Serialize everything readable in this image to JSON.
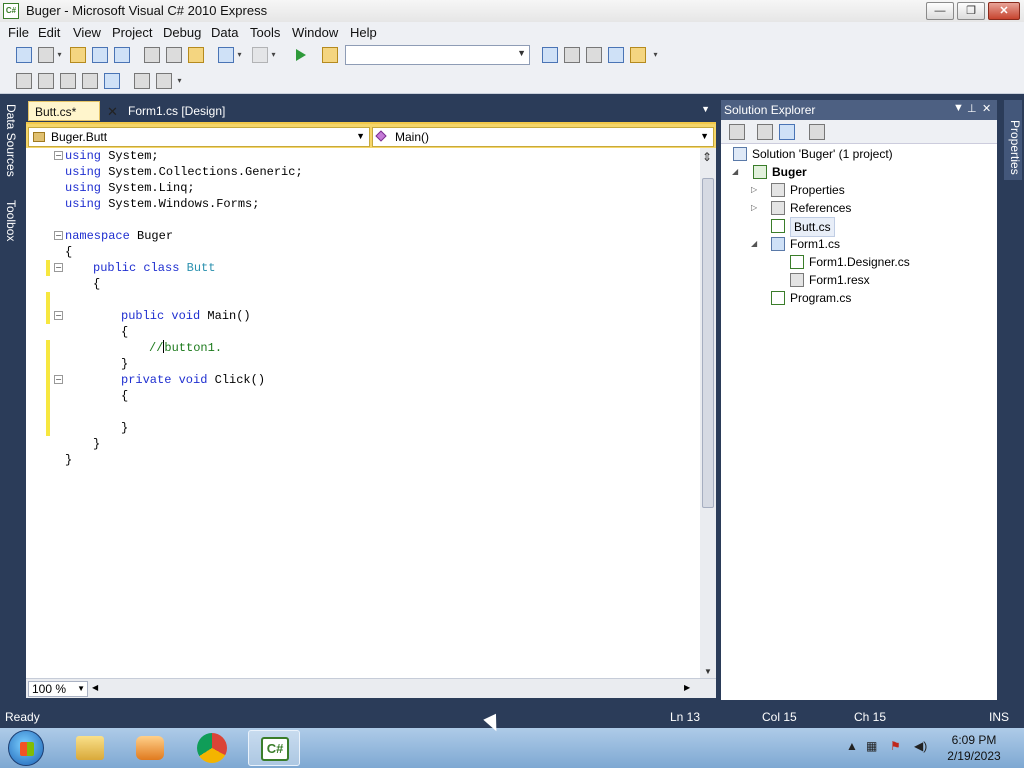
{
  "window": {
    "title": "Buger - Microsoft Visual C# 2010 Express",
    "icon_text": "C#",
    "buttons": {
      "minimize": "—",
      "maximize": "❐",
      "close": "✕"
    }
  },
  "menu": [
    "File",
    "Edit",
    "View",
    "Project",
    "Debug",
    "Data",
    "Tools",
    "Window",
    "Help"
  ],
  "toolbar": {
    "config_combo_value": ""
  },
  "side_tabs": {
    "left_top": "Data Sources",
    "left_bottom": "Toolbox",
    "right": "Properties"
  },
  "editor": {
    "tabs": [
      {
        "label": "Butt.cs*",
        "active": true
      },
      {
        "label": "Form1.cs [Design]",
        "active": false
      }
    ],
    "tab_close": "✕",
    "type_combo": "Buger.Butt",
    "member_combo": "Main()",
    "zoom": "100 %",
    "code": {
      "l1_kw": "using",
      "l1_rest": " System;",
      "l2_kw": "using",
      "l2_rest": " System.Collections.Generic;",
      "l3_kw": "using",
      "l3_rest": " System.Linq;",
      "l4_kw": "using",
      "l4_rest": " System.Windows.Forms;",
      "l6_kw": "namespace",
      "l6_rest": " Buger",
      "l7": "{",
      "l8_kw": "public class",
      "l8_type": "Butt",
      "l9": "{",
      "l11_kw": "public void",
      "l11_rest": " Main()",
      "l12": "{",
      "l13_a": "//",
      "l13_b": "button1.",
      "l14": "}",
      "l15_kw": "private void",
      "l15_rest": " Click()",
      "l16": "{",
      "l18": "}",
      "l19": "}",
      "l20": "}"
    }
  },
  "solution_explorer": {
    "title": "Solution Explorer",
    "nodes": {
      "solution": "Solution 'Buger' (1 project)",
      "project": "Buger",
      "properties": "Properties",
      "references": "References",
      "butt": "Butt.cs",
      "form1": "Form1.cs",
      "form1_designer": "Form1.Designer.cs",
      "form1_resx": "Form1.resx",
      "program": "Program.cs"
    }
  },
  "status": {
    "state": "Ready",
    "line": "Ln 13",
    "col": "Col 15",
    "ch": "Ch 15",
    "mode": "INS"
  },
  "taskbar": {
    "time": "6:09 PM",
    "date": "2/19/2023",
    "active_app_label": "C#"
  },
  "colors": {
    "accent_yellow": "#f5d66a",
    "ide_blue": "#2b3c59",
    "keyword": "#1f2fd0",
    "type": "#2b91af",
    "comment": "#1c7a1c"
  }
}
